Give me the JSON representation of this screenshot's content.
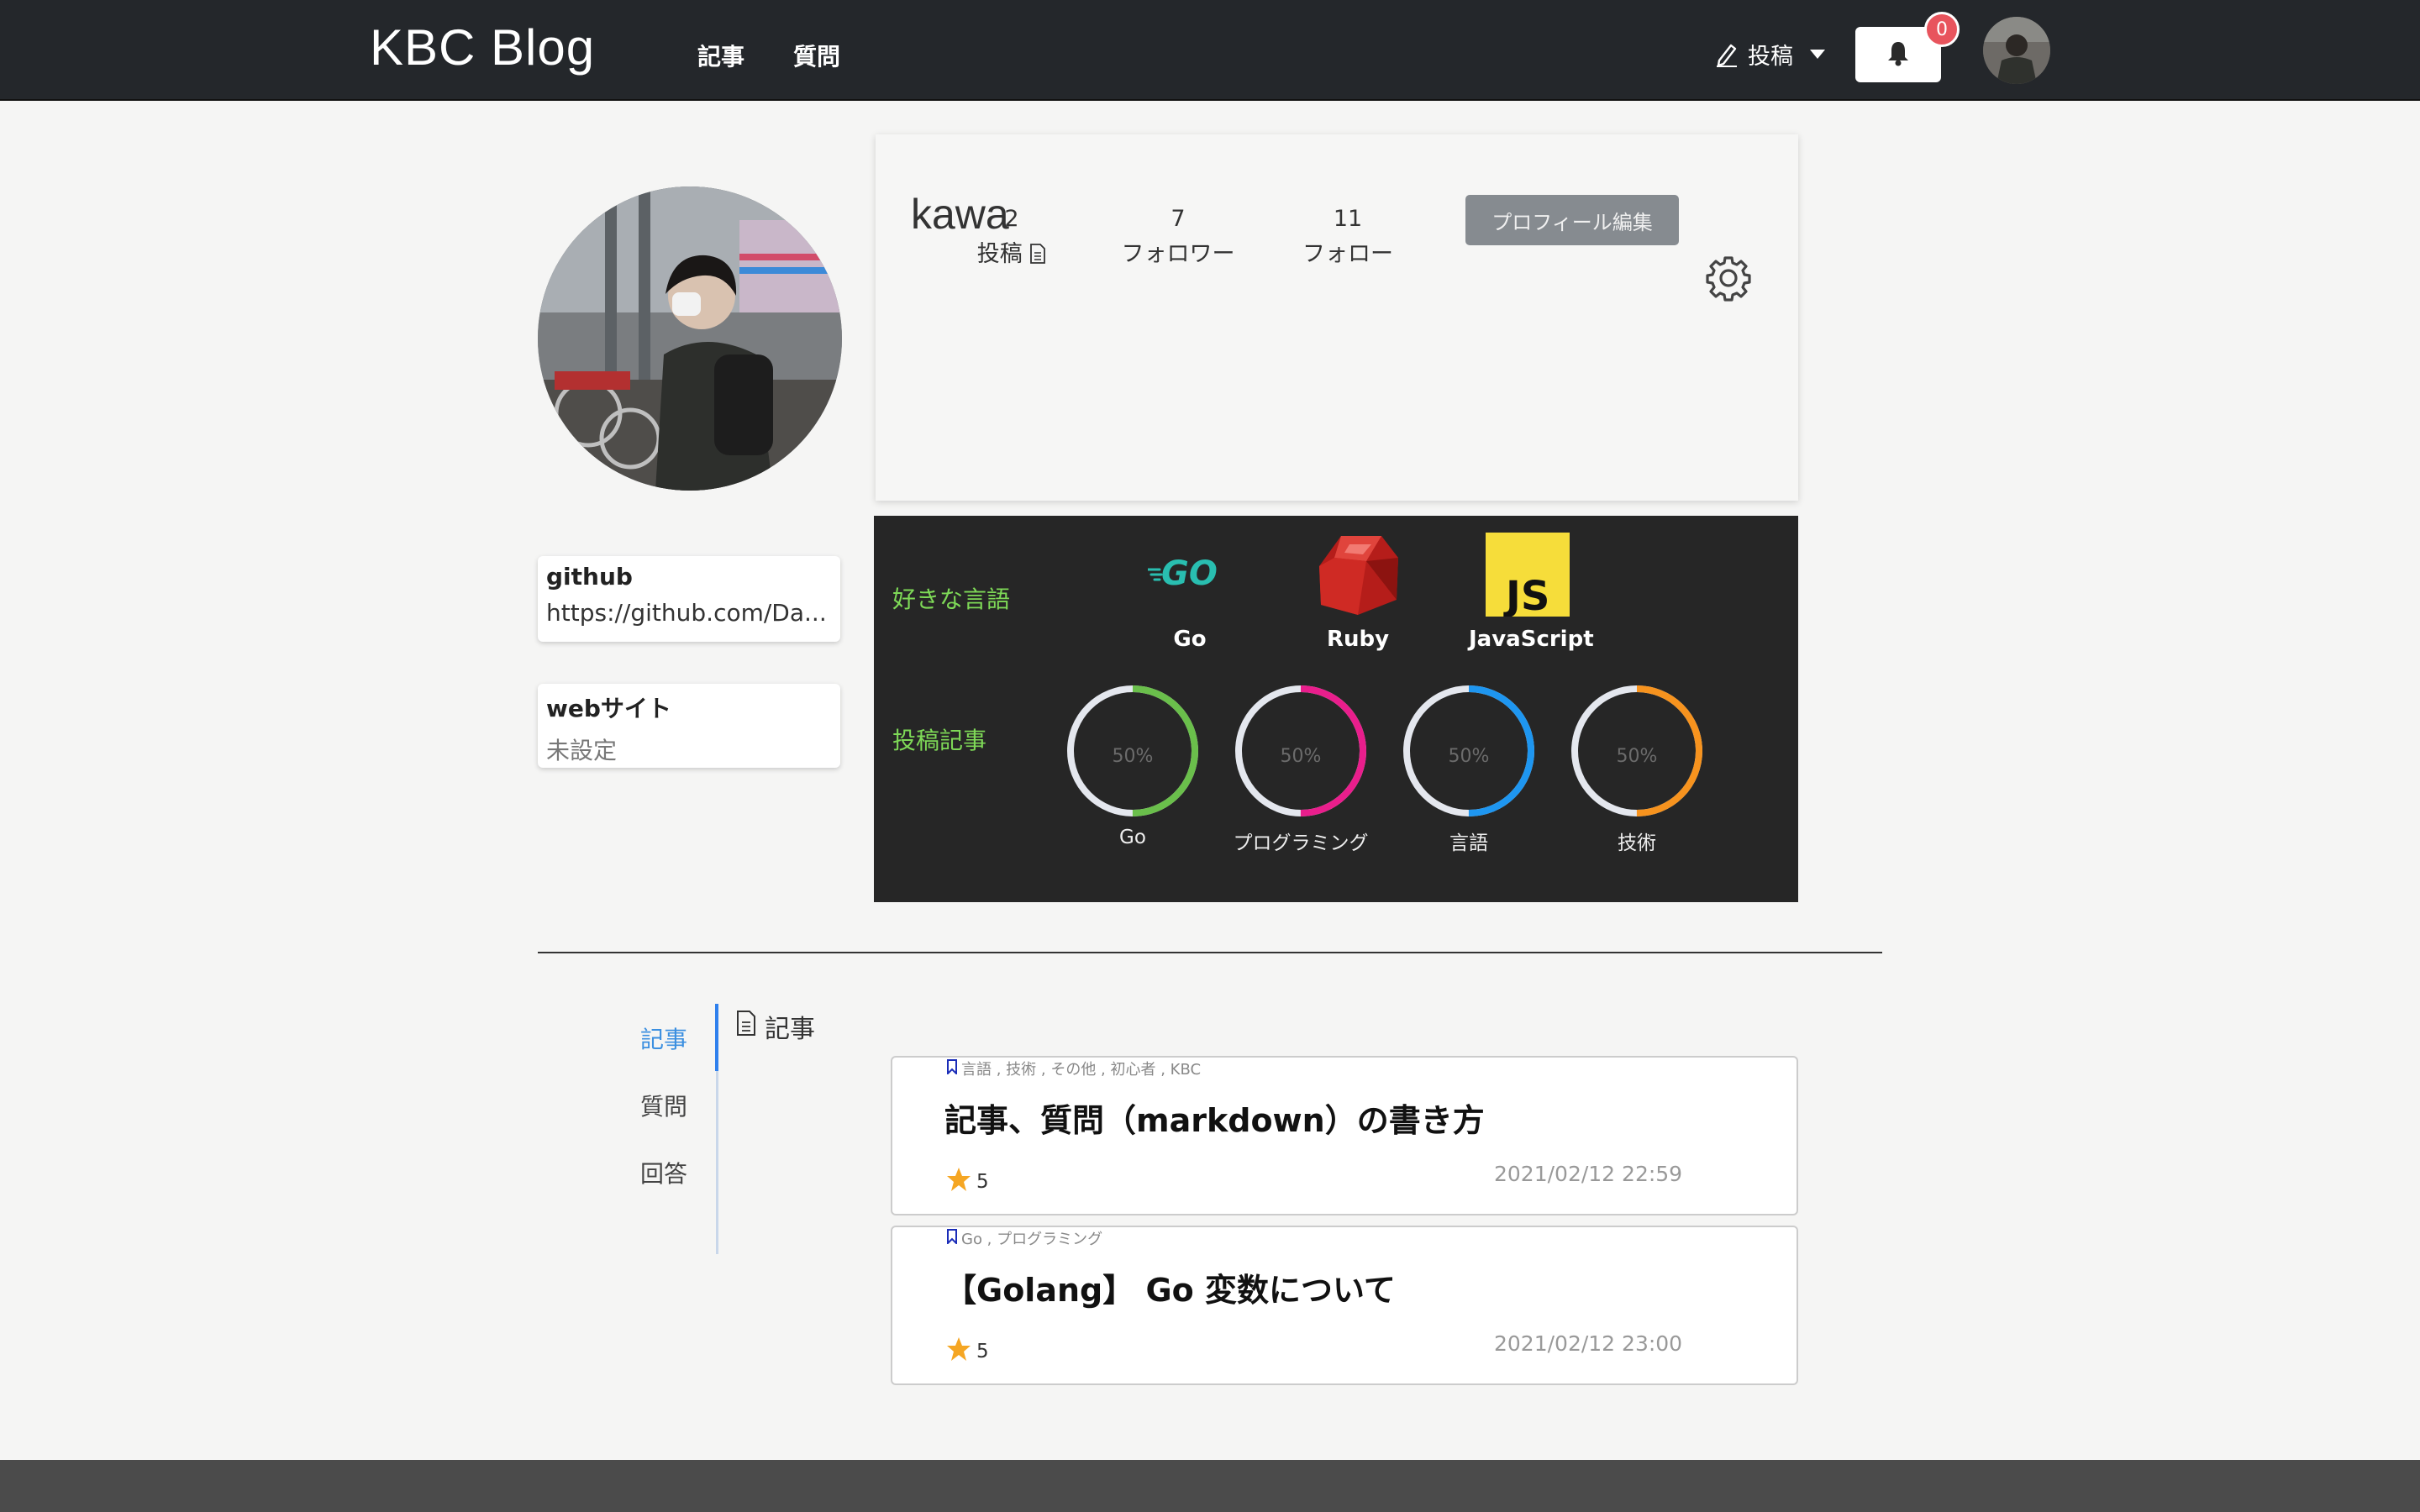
{
  "navbar": {
    "brand": "KBC Blog",
    "links": [
      "記事",
      "質問"
    ],
    "post_menu_label": "投稿",
    "notification_count": "0"
  },
  "profile": {
    "username": "kawa",
    "edit_button": "プロフィール編集",
    "stats": [
      {
        "value": "2",
        "label": "投稿"
      },
      {
        "value": "7",
        "label": "フォロワー"
      },
      {
        "value": "11",
        "label": "フォロー"
      }
    ],
    "github": {
      "label": "github",
      "value": "https://github.com/Da..."
    },
    "website": {
      "label": "webサイト",
      "value": "未設定"
    }
  },
  "skills": {
    "favorite_languages_title": "好きな言語",
    "languages": [
      {
        "name": "Go",
        "icon": "go-logo-icon"
      },
      {
        "name": "Ruby",
        "icon": "ruby-logo-icon"
      },
      {
        "name": "JavaScript",
        "icon": "javascript-logo-icon"
      }
    ],
    "posts_title": "投稿記事",
    "post_categories": [
      {
        "label": "Go",
        "percent": "50%",
        "fraction": 0.5,
        "color": "#6abf4b"
      },
      {
        "label": "プログラミング",
        "percent": "50%",
        "fraction": 0.5,
        "color": "#e91e8c"
      },
      {
        "label": "言語",
        "percent": "50%",
        "fraction": 0.5,
        "color": "#1e96f0"
      },
      {
        "label": "技術",
        "percent": "50%",
        "fraction": 0.5,
        "color": "#f7931e"
      }
    ]
  },
  "tabs": {
    "items": [
      "記事",
      "質問",
      "回答"
    ],
    "active": "記事",
    "section_heading": "記事"
  },
  "articles": [
    {
      "tags": "言語 , 技術 , その他 , 初心者 , KBC",
      "title": "記事、質問（markdown）の書き方",
      "stars": "5",
      "date": "2021/02/12 22:59"
    },
    {
      "tags": "Go , プログラミング",
      "title": "【Golang】 Go 変数について",
      "stars": "5",
      "date": "2021/02/12 23:00"
    }
  ],
  "colors": {
    "navbar": "#24272b",
    "accent_green": "#7ed957",
    "tab_active": "#3b8fe0"
  }
}
